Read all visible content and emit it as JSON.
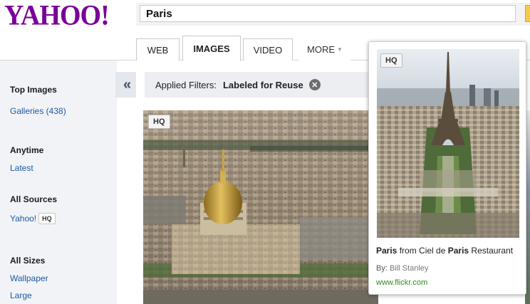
{
  "header": {
    "logo_text": "YAHOO!",
    "search_value": "Paris"
  },
  "tabs": [
    {
      "label": "WEB"
    },
    {
      "label": "IMAGES",
      "active": true
    },
    {
      "label": "VIDEO"
    },
    {
      "label": "MORE"
    }
  ],
  "sidebar": {
    "sections": [
      {
        "heading": "Top Images",
        "links": [
          "Galleries (438)"
        ]
      },
      {
        "heading": "Anytime",
        "links": [
          "Latest"
        ]
      },
      {
        "heading": "All Sources",
        "links": [
          "Yahoo!"
        ],
        "badge": "HQ"
      },
      {
        "heading": "All Sizes",
        "links": [
          "Wallpaper",
          "Large"
        ]
      }
    ],
    "collapse_glyph": "«"
  },
  "filters": {
    "label": "Applied Filters:",
    "value": "Labeled for Reuse",
    "clear_glyph": "✕"
  },
  "results": {
    "main_badge": "HQ"
  },
  "popup": {
    "badge": "HQ",
    "title_bold_1": "Paris",
    "title_mid": " from Ciel de ",
    "title_bold_2": "Paris",
    "title_end": " Restaurant",
    "by_label": "By: ",
    "author": "Bill Stanley",
    "source": "www.flickr.com"
  },
  "colors": {
    "logo": "#7b0099",
    "link": "#1d5a9e",
    "source_link": "#2e8b1e",
    "sidebar_bg": "#f1f3f7"
  }
}
